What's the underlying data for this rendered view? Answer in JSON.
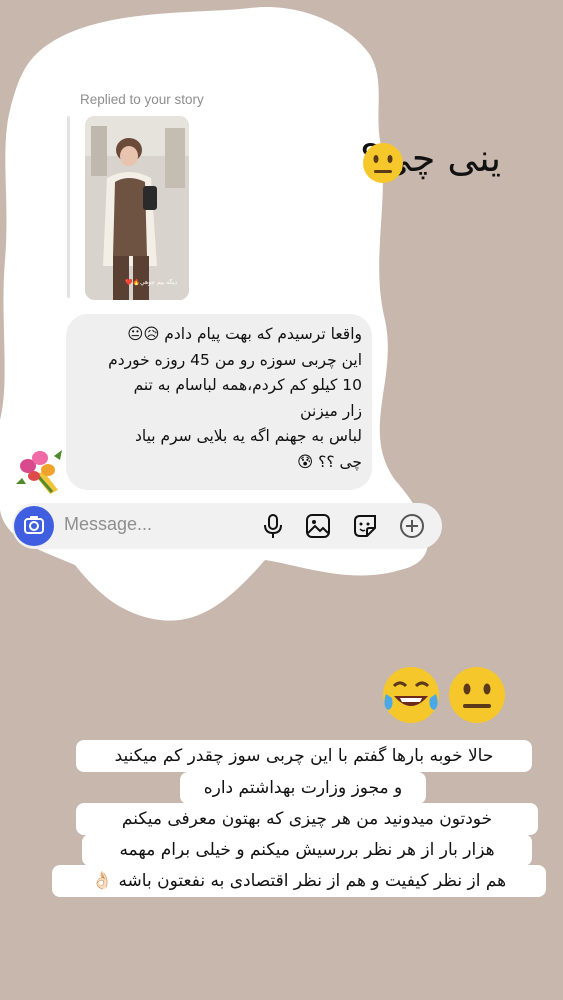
{
  "header": {
    "replied_label": "Replied to your story"
  },
  "story": {
    "caption": "ديگه بيم جوهي🔥❤️"
  },
  "message": {
    "text": "واقعا ترسیدم که بهت پیام دادم 😥😐\nاین چربی سوزه رو من 45 روزه خوردم\n10 کیلو کم کردم،همه لباسام به تنم\nزار میزنن\nلباس به جهنم اگه یه بلایی سرم بیاد\nچی ؟؟ 😰"
  },
  "composer": {
    "placeholder": "Message..."
  },
  "overlay": {
    "side_text": "ینی چی؟",
    "caption_lines": [
      "حالا خوبه بارها گفتم با این چربی سوز چقدر کم میکنید",
      "و مجوز وزارت بهداشتم داره",
      "خودتون میدونید من هر چیزی که بهتون معرفی میکنم",
      "هزار بار از هر نظر بررسیش میکنم و خیلی برام مهمه",
      "هم از نظر کیفیت و هم از نظر اقتصادی به نفعتون باشه 👌🏻"
    ]
  },
  "colors": {
    "background": "#c8b7ad",
    "bubble": "#efefef",
    "camera_button": "#3f5fe0",
    "muted_text": "#8e8e8e"
  }
}
